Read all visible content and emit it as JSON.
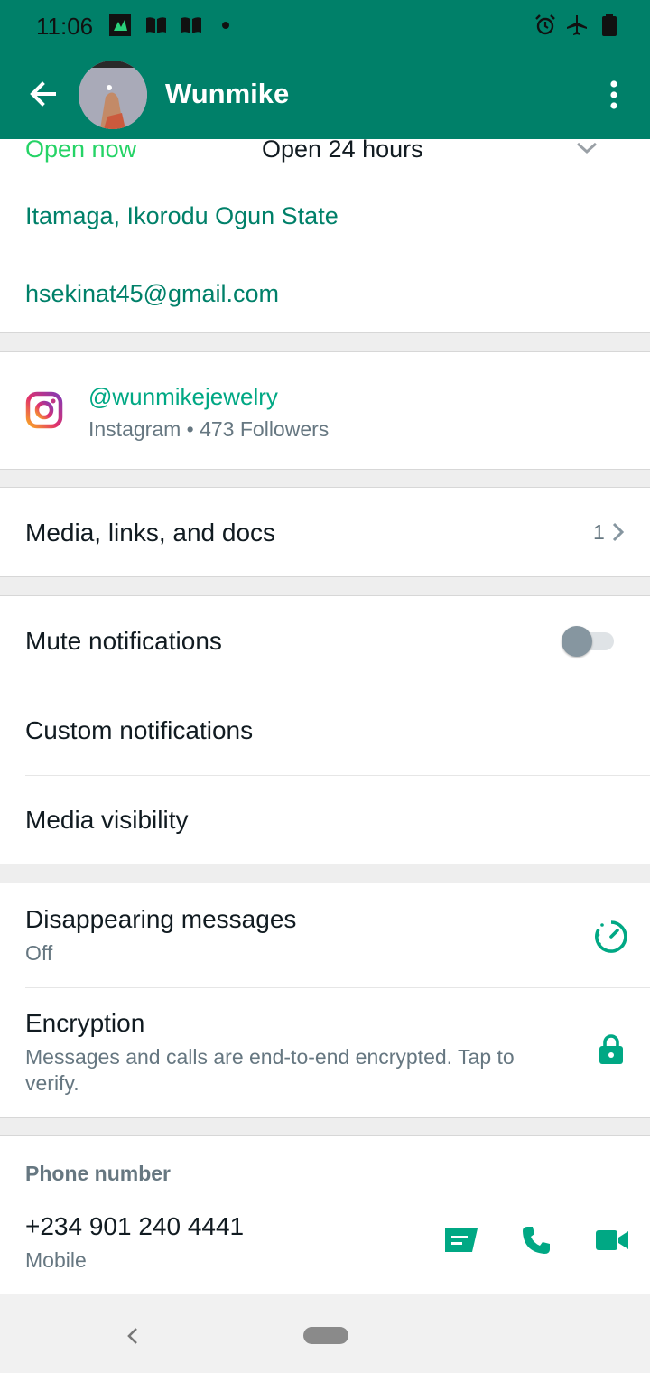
{
  "status_bar": {
    "time": "11:06",
    "icons": [
      "app-notification-icon",
      "book-icon",
      "book-icon",
      "dot-icon",
      "alarm-icon",
      "airplane-icon",
      "battery-icon"
    ]
  },
  "app_bar": {
    "title": "Wunmike",
    "icons": [
      "back-arrow-icon",
      "more-vert-icon"
    ]
  },
  "business_info": {
    "hours_status": "Open now",
    "hours_detail": "Open 24 hours",
    "address": "Itamaga, Ikorodu Ogun State",
    "email": "hsekinat45@gmail.com"
  },
  "instagram": {
    "handle": "@wunmikejewelry",
    "subtitle": "Instagram • 473 Followers"
  },
  "media": {
    "label": "Media, links, and docs",
    "count": "1"
  },
  "notifications": {
    "mute_label": "Mute notifications",
    "mute_on": false,
    "custom_label": "Custom notifications",
    "visibility_label": "Media visibility"
  },
  "privacy": {
    "disappearing_label": "Disappearing messages",
    "disappearing_value": "Off",
    "encryption_label": "Encryption",
    "encryption_desc_line1": "Messages and calls are end-to-end encrypted. Tap to",
    "encryption_desc_line2": "verify."
  },
  "phone": {
    "header": "Phone number",
    "number": "+234 901 240 4441",
    "type": "Mobile"
  },
  "colors": {
    "brand": "#008069",
    "accent": "#00a884"
  }
}
